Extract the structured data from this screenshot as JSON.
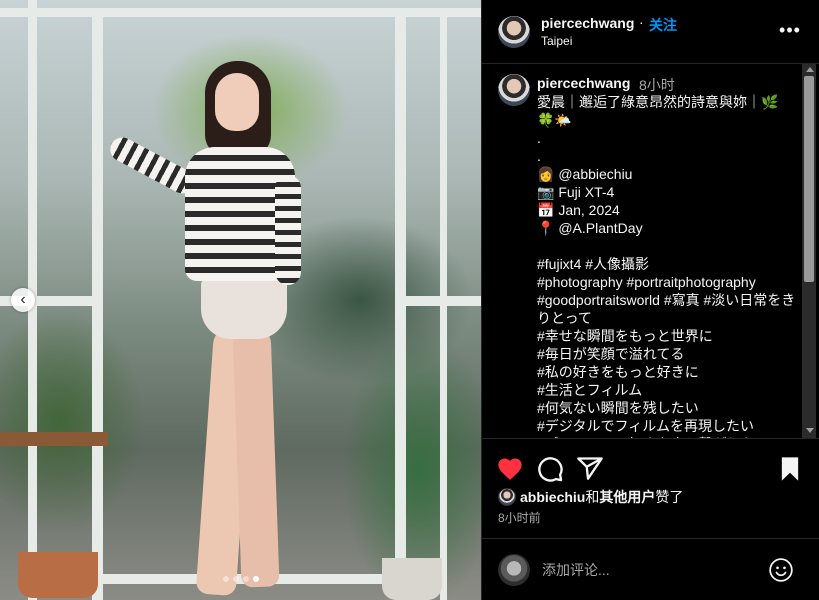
{
  "post": {
    "username": "piercechwang",
    "separator": "·",
    "follow_label": "关注",
    "location": "Taipei",
    "more_icon": "more-horizontal-icon",
    "carousel": {
      "slide_count": 4,
      "active_index": 3,
      "prev_icon": "chevron-left-icon"
    }
  },
  "caption": {
    "username": "piercechwang",
    "time_ago": "8小时",
    "text": "愛晨｜邂逅了綠意昂然的詩意與妳｜🌿\n🍀🌤️\n.\n.\n👩 @abbiechiu\n📷 Fuji XT-4\n📅 Jan, 2024\n📍 @A.PlantDay\n\n#fujixt4 #人像攝影\n#photography #portraitphotography\n#goodportraitsworld #寫真 #淡い日常をきりとって\n#幸せな瞬間をもっと世界に\n#毎日が笑顔で溢れてる\n#私の好きをもっと好きに\n#生活とフィルム\n#何気ない瞬間を残したい\n#デジタルでフィルムを再現したい\n#ポートレート好きな人と繋がりたい"
  },
  "actions": {
    "like_icon": "heart-filled-icon",
    "comment_icon": "comment-icon",
    "share_icon": "share-icon",
    "save_icon": "bookmark-icon",
    "like_color": "#ff3040"
  },
  "likes": {
    "first_user": "abbiechiu",
    "connector": "和",
    "others": "其他用户",
    "suffix": "赞了"
  },
  "post_time": "8小时前",
  "comment_box": {
    "placeholder": "添加评论...",
    "emoji_icon": "smiley-icon"
  }
}
